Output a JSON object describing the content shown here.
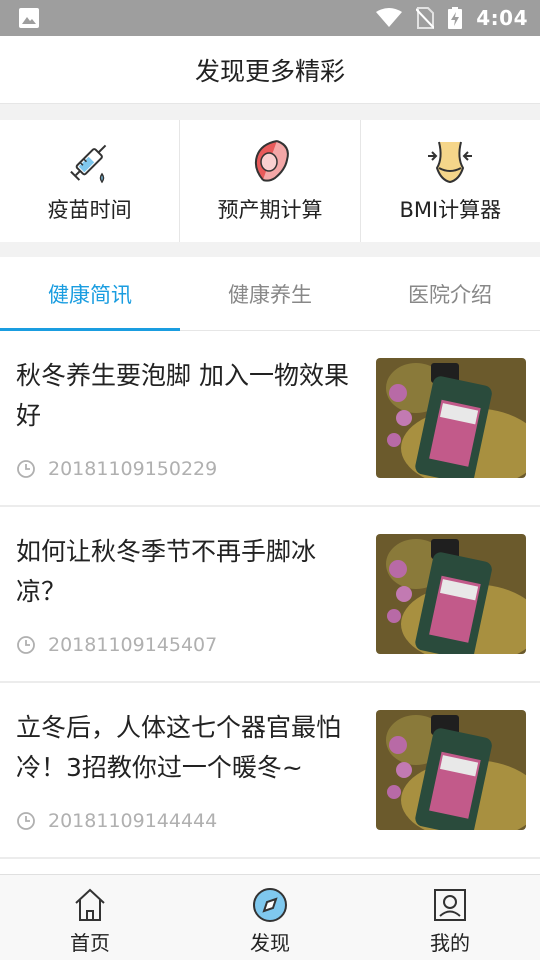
{
  "status": {
    "time": "4:04"
  },
  "header": {
    "title": "发现更多精彩"
  },
  "tools": [
    {
      "label": "疫苗时间",
      "icon": "syringe-icon"
    },
    {
      "label": "预产期计算",
      "icon": "pregnancy-icon"
    },
    {
      "label": "BMI计算器",
      "icon": "waist-icon"
    }
  ],
  "tabs": [
    {
      "label": "健康简讯",
      "active": true
    },
    {
      "label": "健康养生",
      "active": false
    },
    {
      "label": "医院介绍",
      "active": false
    }
  ],
  "articles": [
    {
      "title": "秋冬养生要泡脚 加入一物效果好",
      "time": "20181109150229"
    },
    {
      "title": "如何让秋冬季节不再手脚冰凉？",
      "time": "20181109145407"
    },
    {
      "title": "立冬后，人体这七个器官最怕冷！3招教你过一个暖冬~",
      "time": "20181109144444"
    }
  ],
  "bottom_nav": [
    {
      "label": "首页",
      "icon": "home-icon"
    },
    {
      "label": "发现",
      "icon": "compass-icon"
    },
    {
      "label": "我的",
      "icon": "profile-icon"
    }
  ],
  "colors": {
    "accent": "#1a9de0",
    "statusbar": "#9e9e9e",
    "icon_red": "#e85a5a",
    "icon_yellow": "#f5c542"
  }
}
